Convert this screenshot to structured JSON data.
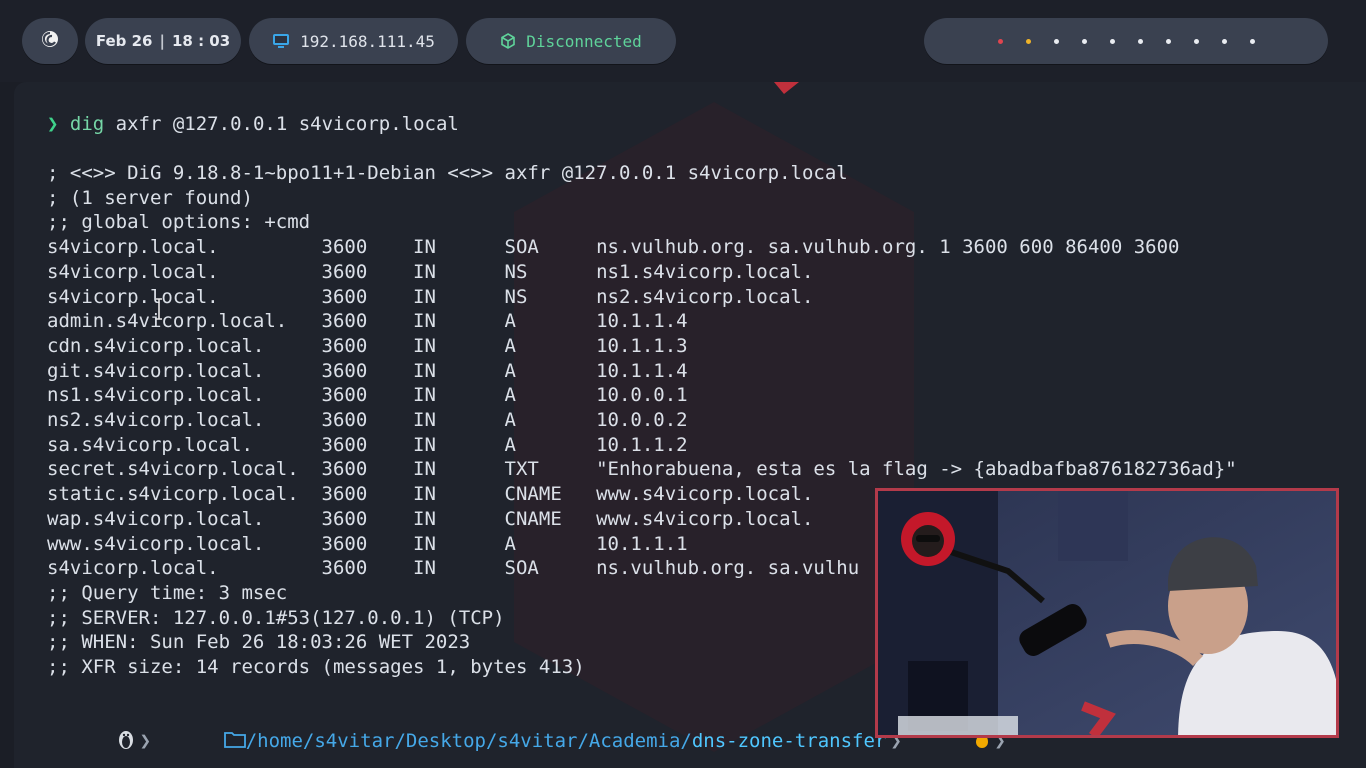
{
  "topbar": {
    "date": "Feb 26",
    "time": "18 : 03",
    "ip": "192.168.111.45",
    "vpn_status": "Disconnected",
    "workspace_count": 10,
    "workspace_colors": [
      "#e0454f",
      "#f0b429",
      "#e9ecf1",
      "#e9ecf1",
      "#e9ecf1",
      "#e9ecf1",
      "#e9ecf1",
      "#e9ecf1",
      "#e9ecf1",
      "#e9ecf1"
    ],
    "icons": {
      "logo": "debian-icon",
      "ip": "monitor-icon",
      "vpn": "cube-icon"
    }
  },
  "terminal": {
    "prompt_symbol": "❯",
    "command_name": "dig",
    "command_args": " axfr @127.0.0.1 s4vicorp.local",
    "output": [
      "; <<>> DiG 9.18.8-1~bpo11+1-Debian <<>> axfr @127.0.0.1 s4vicorp.local",
      "; (1 server found)",
      ";; global options: +cmd",
      "s4vicorp.local.         3600    IN      SOA     ns.vulhub.org. sa.vulhub.org. 1 3600 600 86400 3600",
      "s4vicorp.local.         3600    IN      NS      ns1.s4vicorp.local.",
      "s4vicorp.local.         3600    IN      NS      ns2.s4vicorp.local.",
      "admin.s4vicorp.local.   3600    IN      A       10.1.1.4",
      "cdn.s4vicorp.local.     3600    IN      A       10.1.1.3",
      "git.s4vicorp.local.     3600    IN      A       10.1.1.4",
      "ns1.s4vicorp.local.     3600    IN      A       10.0.0.1",
      "ns2.s4vicorp.local.     3600    IN      A       10.0.0.2",
      "sa.s4vicorp.local.      3600    IN      A       10.1.1.2",
      "secret.s4vicorp.local.  3600    IN      TXT     \"Enhorabuena, esta es la flag -> {abadbafba876182736ad}\"",
      "static.s4vicorp.local.  3600    IN      CNAME   www.s4vicorp.local.",
      "wap.s4vicorp.local.     3600    IN      CNAME   www.s4vicorp.local.",
      "www.s4vicorp.local.     3600    IN      A       10.1.1.1",
      "s4vicorp.local.         3600    IN      SOA     ns.vulhub.org. sa.vulhu",
      ";; Query time: 3 msec",
      ";; SERVER: 127.0.0.1#53(127.0.0.1) (TCP)",
      ";; WHEN: Sun Feb 26 18:03:26 WET 2023",
      ";; XFR size: 14 records (messages 1, bytes 413)"
    ]
  },
  "pathbar": {
    "os_icon": "linux-tux-icon",
    "folder_icon": "folder-icon",
    "path_prefix": "/home/s4vitar/Desktop/s4vitar/Academia/",
    "path_current": "dns-zone-transfer",
    "status_icon": "flame-icon"
  },
  "webcam": {
    "icon": "webcam-overlay"
  }
}
